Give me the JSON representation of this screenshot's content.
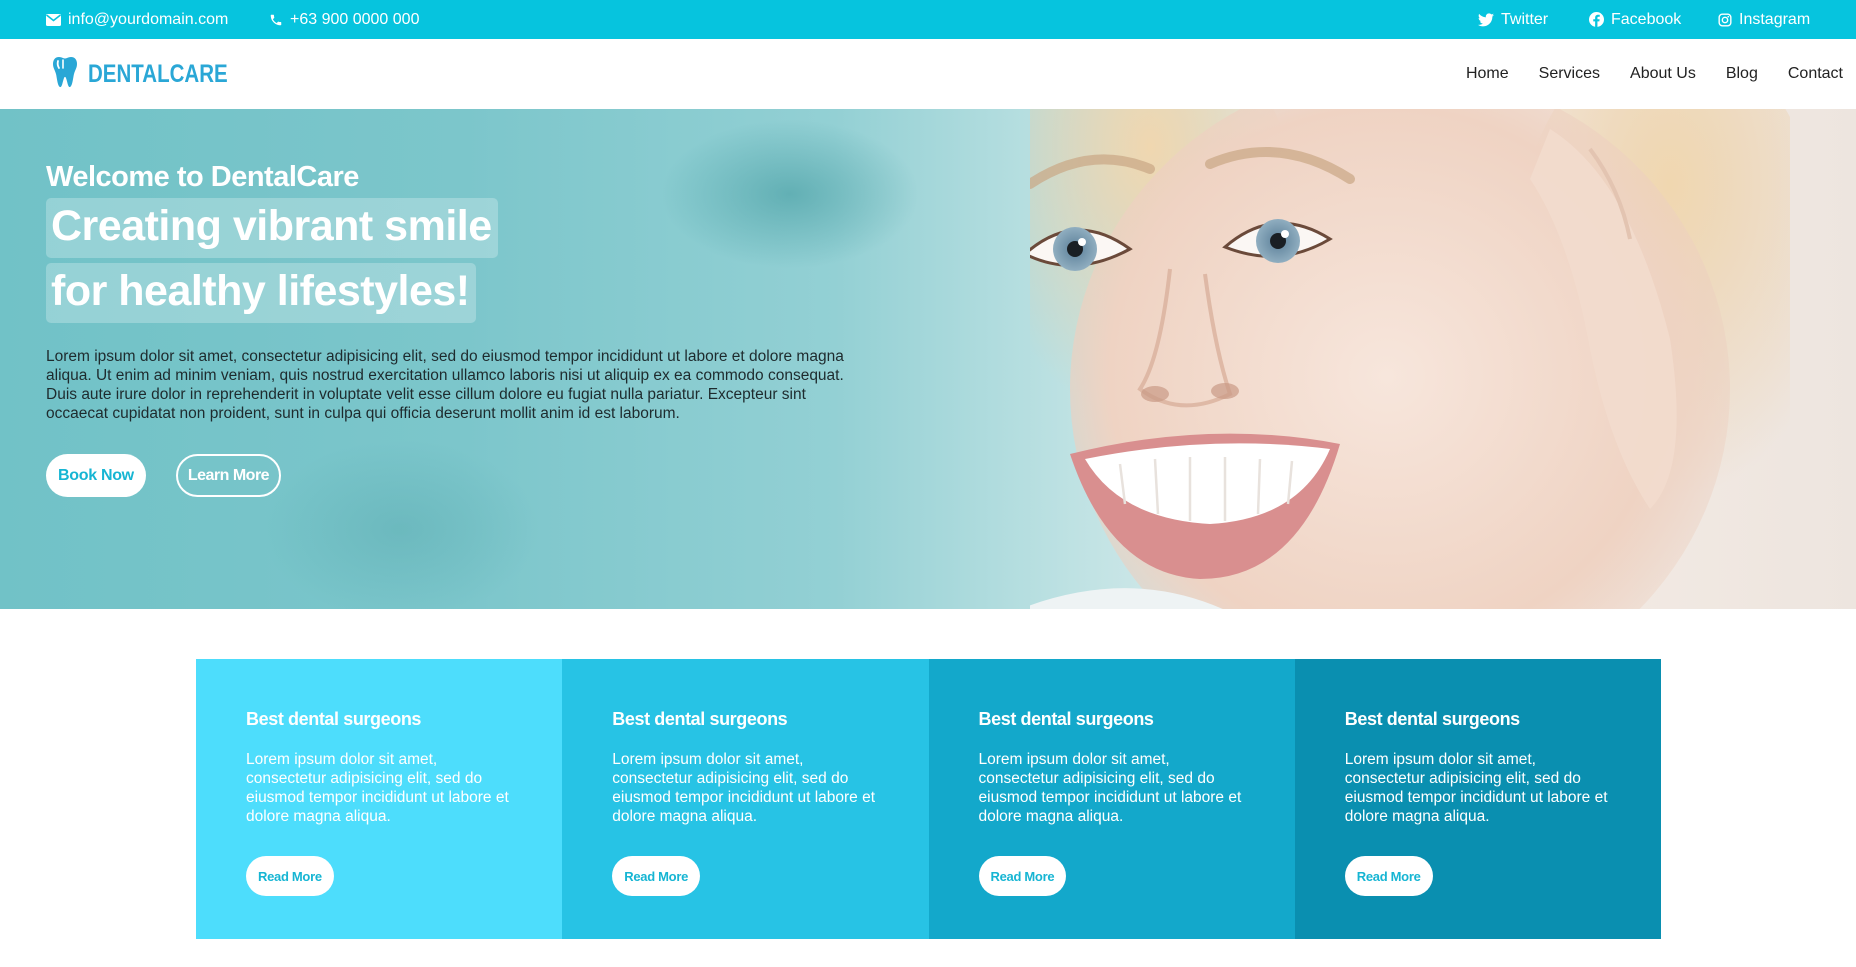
{
  "topbar": {
    "email": "info@yourdomain.com",
    "phone": "+63 900 0000 000",
    "social": [
      {
        "label": "Twitter",
        "icon": "twitter-icon"
      },
      {
        "label": "Facebook",
        "icon": "facebook-icon"
      },
      {
        "label": "Instagram",
        "icon": "instagram-icon"
      }
    ]
  },
  "brand": {
    "name": "DENTALCARE",
    "icon": "tooth-icon"
  },
  "nav": {
    "items": [
      "Home",
      "Services",
      "About Us",
      "Blog",
      "Contact"
    ]
  },
  "hero": {
    "welcome": "Welcome to DentalCare",
    "headline1": "Creating vibrant smile",
    "headline2": "for healthy lifestyles!",
    "paragraph": "Lorem ipsum dolor sit amet, consectetur adipisicing elit, sed do eiusmod tempor incididunt ut labore et dolore magna aliqua. Ut enim ad minim veniam, quis nostrud exercitation ullamco laboris nisi ut aliquip ex ea commodo consequat. Duis aute irure dolor in reprehenderit in voluptate velit esse cillum dolore eu fugiat nulla pariatur. Excepteur sint occaecat cupidatat non proident, sunt in culpa qui officia deserunt mollit anim id est laborum.",
    "book_label": "Book Now",
    "learn_label": "Learn More"
  },
  "cards": [
    {
      "title": "Best dental surgeons",
      "text": "Lorem ipsum dolor sit amet, consectetur adipisicing elit, sed do eiusmod tempor incididunt ut labore et dolore magna aliqua.",
      "button": "Read More",
      "color": "#4dddfc"
    },
    {
      "title": "Best dental surgeons",
      "text": "Lorem ipsum dolor sit amet, consectetur adipisicing elit, sed do eiusmod tempor incididunt ut labore et dolore magna aliqua.",
      "button": "Read More",
      "color": "#27c3e5"
    },
    {
      "title": "Best dental surgeons",
      "text": "Lorem ipsum dolor sit amet, consectetur adipisicing elit, sed do eiusmod tempor incididunt ut labore et dolore magna aliqua.",
      "button": "Read More",
      "color": "#13a8cb"
    },
    {
      "title": "Best dental surgeons",
      "text": "Lorem ipsum dolor sit amet, consectetur adipisicing elit, sed do eiusmod tempor incididunt ut labore et dolore magna aliqua.",
      "button": "Read More",
      "color": "#0a8fb0"
    }
  ],
  "colors": {
    "accent": "#06c4de",
    "brand": "#2aa7d6"
  }
}
